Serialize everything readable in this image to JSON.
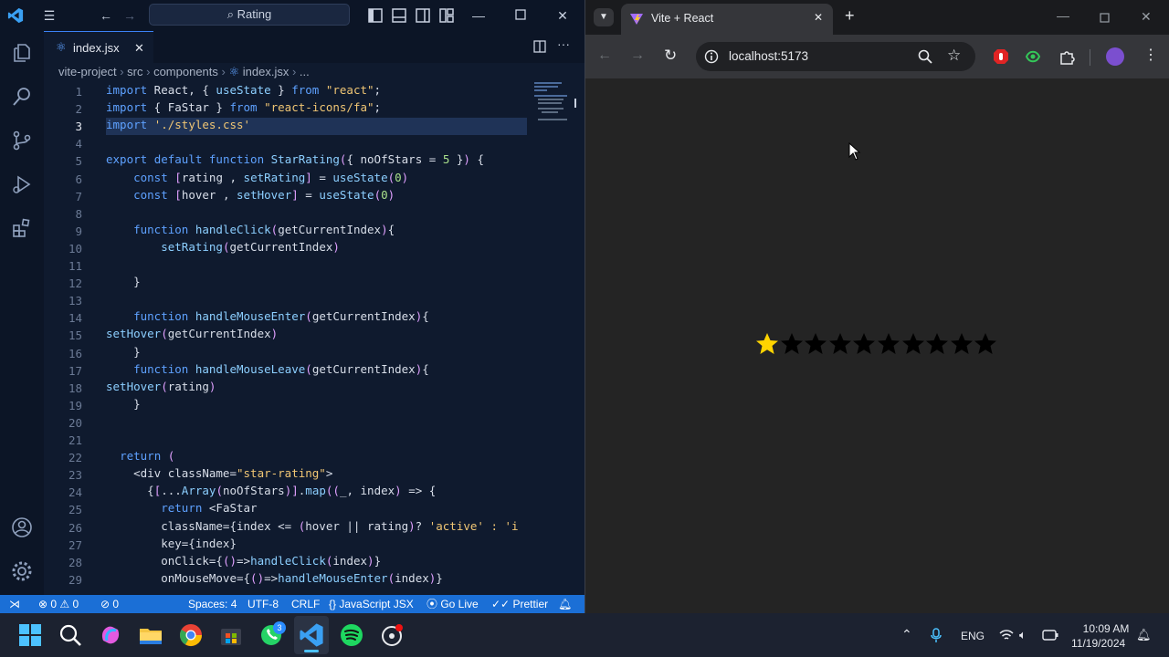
{
  "vscode": {
    "search": "Rating",
    "tab": {
      "filename": "index.jsx",
      "close": "✕"
    },
    "breadcrumb": [
      "vite-project",
      "src",
      "components",
      "index.jsx",
      "..."
    ],
    "line_numbers": [
      "1",
      "2",
      "3",
      "4",
      "5",
      "6",
      "7",
      "8",
      "9",
      "10",
      "11",
      "12",
      "13",
      "14",
      "15",
      "16",
      "17",
      "18",
      "19",
      "20",
      "21",
      "22",
      "23",
      "24",
      "25",
      "26",
      "27",
      "28",
      "29"
    ],
    "status": {
      "errors": "0",
      "warnings": "0",
      "ports": "0",
      "spaces": "Spaces: 4",
      "encoding": "UTF-8",
      "eol": "CRLF",
      "language": "JavaScript JSX",
      "golive": "Go Live",
      "prettier": "Prettier"
    },
    "code_lines": [
      "import React, { useState } from \"react\";",
      "import { FaStar } from \"react-icons/fa\";",
      "import './styles.css'",
      "",
      "export default function StarRating({ noOfStars = 5 }) {",
      "    const [rating , setRating] = useState(0)",
      "    const [hover , setHover] = useState(0)",
      "",
      "    function handleClick(getCurrentIndex){",
      "        setRating(getCurrentIndex)",
      "",
      "    }",
      "",
      "    function handleMouseEnter(getCurrentIndex){",
      "setHover(getCurrentIndex)",
      "    }",
      "    function handleMouseLeave(getCurrentIndex){",
      "setHover(rating)",
      "    }",
      "",
      "",
      "  return (",
      "    <div className=\"star-rating\">",
      "      {[...Array(noOfStars)].map((_, index) => {",
      "        return <FaStar",
      "        className={index <= (hover || rating)? 'active' : 'i",
      "        key={index}",
      "        onClick={()=>handleClick(index)}",
      "        onMouseMove={()=>handleMouseEnter(index)}"
    ]
  },
  "browser": {
    "tab_title": "Vite + React",
    "url": "localhost:5173",
    "stars": {
      "total": 10,
      "filled": 1,
      "filled_color": "#ffd400",
      "empty_color": "#000000"
    }
  },
  "taskbar": {
    "language": "ENG",
    "time": "10:09 AM",
    "date": "11/19/2024",
    "whatsapp_badge": "3"
  },
  "colors": {
    "vscode_status": "#1b6fd6",
    "browser_bg": "#242424"
  }
}
